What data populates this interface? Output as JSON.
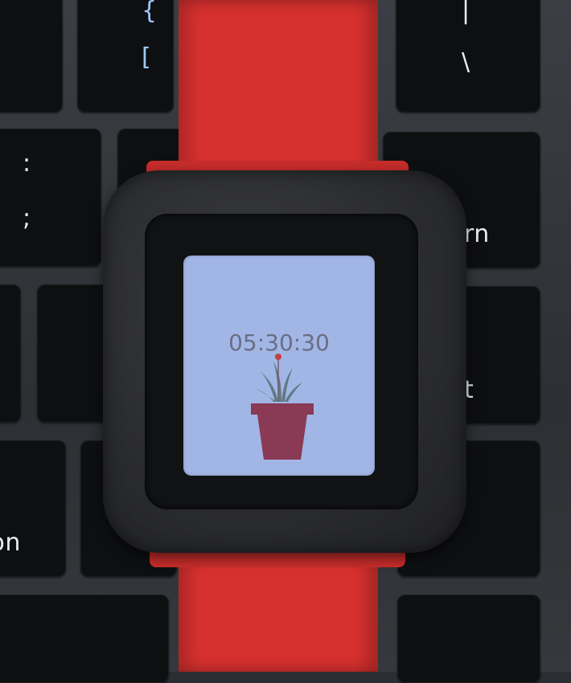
{
  "watch": {
    "time_display": "05:30:30",
    "screen_color": "#a2b6e6",
    "strap_color": "#d6312f",
    "case_color": "#2b2c2e"
  },
  "keyboard": {
    "legends": {
      "brace": "{",
      "bracket": "[",
      "pipe": "|",
      "backslash": "\\",
      "colon": ":",
      "semicolon": ";",
      "return": "return",
      "shift": "shift",
      "option": "option",
      "arrow": "▶"
    }
  },
  "plant": {
    "pot_color": "#8a3a55",
    "leaf_color": "#5f7a86",
    "flower_color": "#c0413f"
  }
}
